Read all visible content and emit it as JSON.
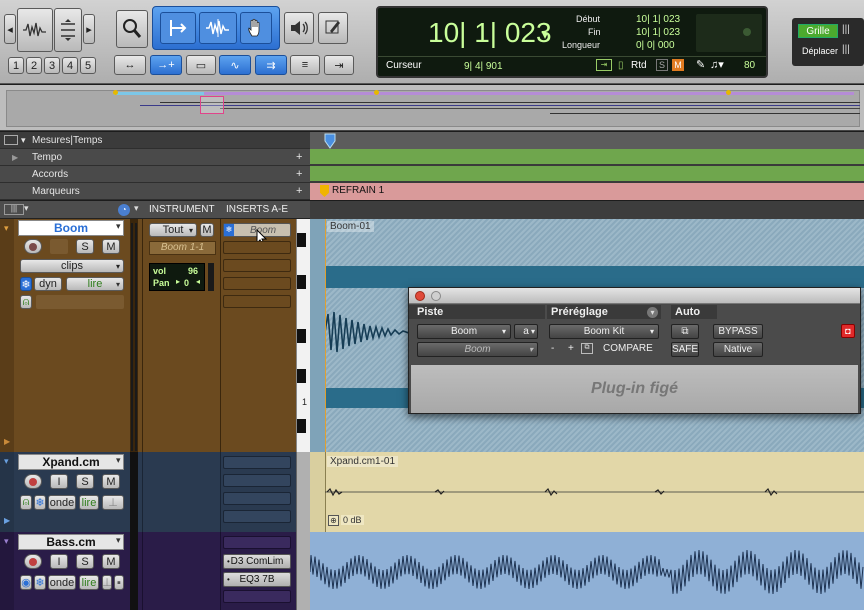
{
  "toolbar": {
    "zoom_presets": [
      "1",
      "2",
      "3",
      "4",
      "5"
    ],
    "counter": {
      "main": "10| 1| 023",
      "start_label": "Début",
      "end_label": "Fin",
      "length_label": "Longueur",
      "start": "10| 1| 023",
      "end": "10| 1| 023",
      "length": "0| 0| 000",
      "cursor_label": "Curseur",
      "cursor": "9| 4| 901",
      "rtd_label": "Rtd",
      "s_label": "S",
      "m_label": "M",
      "tempo": "80"
    },
    "grid_label": "Grille",
    "move_label": "Déplacer"
  },
  "rulers": {
    "mesures": "Mesures|Temps",
    "tempo": "Tempo",
    "accords": "Accords",
    "marqueurs": "Marqueurs",
    "marker_name": "REFRAIN 1"
  },
  "columns": {
    "instrument": "INSTRUMENT",
    "inserts": "INSERTS A-E"
  },
  "tracks": [
    {
      "name": "Boom",
      "s": "S",
      "m": "M",
      "mode": "clips",
      "dyn": "dyn",
      "auto": "lire",
      "instr_sel": "Tout",
      "instr_m": "M",
      "instr_name": "Boom 1-1",
      "vol_label": "vol",
      "vol": "96",
      "pan_label": "Pan",
      "pan": "0",
      "insert1": "Boom",
      "clip": "Boom-01",
      "ruler_num": "1"
    },
    {
      "name": "Xpand.cm",
      "i": "I",
      "s": "S",
      "m": "M",
      "mode": "onde",
      "auto": "lire",
      "clip": "Xpand.cm1-01",
      "clip_gain": "0 dB"
    },
    {
      "name": "Bass.cm",
      "i": "I",
      "s": "S",
      "m": "M",
      "mode": "onde",
      "auto": "lire",
      "insert1": "D3 ComLim",
      "insert2": "EQ3 7B"
    }
  ],
  "plugin": {
    "col_track": "Piste",
    "col_preset": "Préréglage",
    "col_auto": "Auto",
    "track_sel": "Boom",
    "track_slot": "a",
    "instrument": "Boom",
    "preset": "Boom Kit",
    "compare": "COMPARE",
    "bypass": "BYPASS",
    "safe": "SAFE",
    "native": "Native",
    "minus": "-",
    "plus": "+",
    "frozen": "Plug-in figé"
  }
}
